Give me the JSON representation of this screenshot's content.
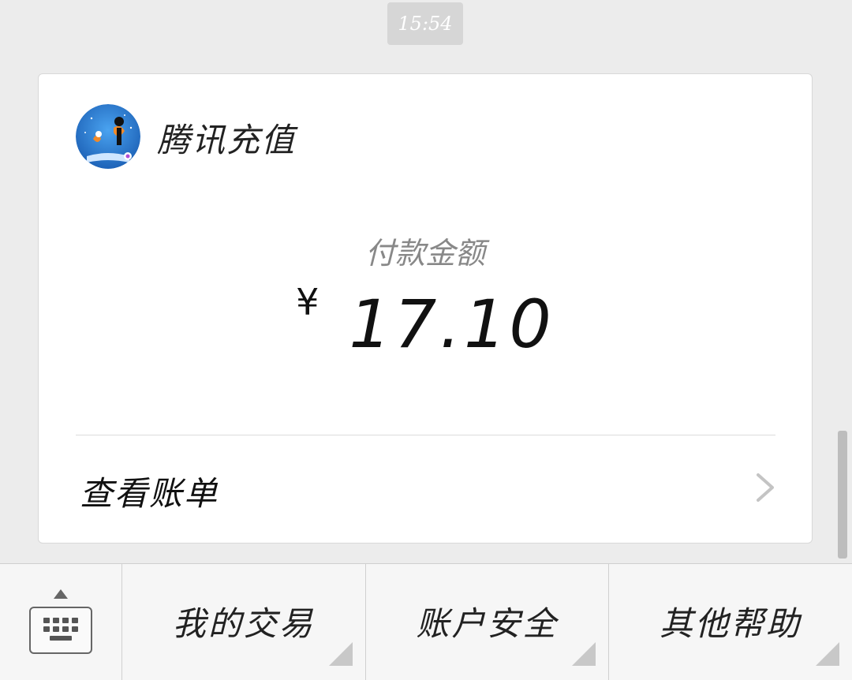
{
  "timestamp": "15:54",
  "card": {
    "merchant_name": "腾讯充值",
    "amount_label": "付款金额",
    "currency_symbol": "¥",
    "amount": "17.10",
    "view_bill_label": "查看账单"
  },
  "menu": {
    "items": [
      {
        "label": "我的交易"
      },
      {
        "label": "账户安全"
      },
      {
        "label": "其他帮助"
      }
    ]
  },
  "colors": {
    "background": "#ececec",
    "card": "#ffffff",
    "timestamp_bg": "#d6d6d6",
    "avatar_bg": "#2f7fd6",
    "scrollbar": "#bdbdbd"
  },
  "icons": {
    "keyboard": "keyboard-icon",
    "chevron": "chevron-right-icon",
    "avatar": "avatar"
  }
}
